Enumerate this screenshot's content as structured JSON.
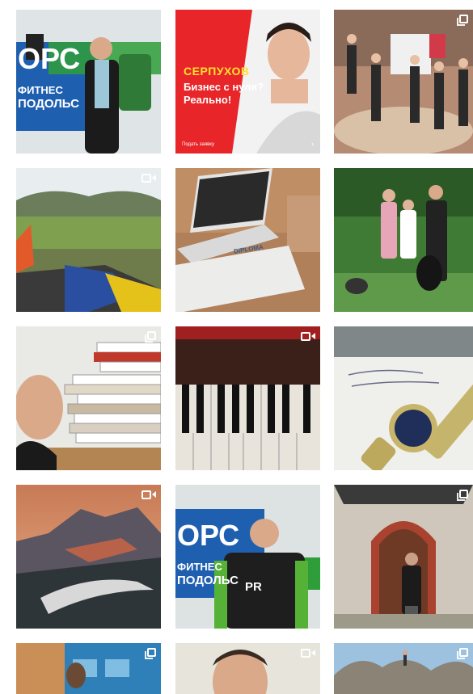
{
  "grid": {
    "tiles": [
      {
        "name": "post-fitness-event",
        "badge": "none"
      },
      {
        "name": "post-ad-serpukhov",
        "badge": "none",
        "ad": {
          "city": "СЕРПУХОВ",
          "headline": "Бизнес с нуля? Реально!",
          "cta": "Подать заявку",
          "arrow": "›"
        }
      },
      {
        "name": "post-group-dancers",
        "badge": "multi"
      },
      {
        "name": "post-motorbike-field",
        "badge": "video"
      },
      {
        "name": "post-diploma-laptop",
        "badge": "none",
        "diploma_title": "DIPLOMA"
      },
      {
        "name": "post-family-dog",
        "badge": "none"
      },
      {
        "name": "post-books-stack",
        "badge": "multi"
      },
      {
        "name": "post-piano-keys",
        "badge": "video"
      },
      {
        "name": "post-watch-note",
        "badge": "none"
      },
      {
        "name": "post-mountain-sunset",
        "badge": "video"
      },
      {
        "name": "post-jersey-logo",
        "badge": "none",
        "jersey_text": "PR"
      },
      {
        "name": "post-arched-door",
        "badge": "multi"
      },
      {
        "name": "post-city-street",
        "badge": "multi"
      },
      {
        "name": "post-selfie",
        "badge": "video"
      },
      {
        "name": "post-rock-landscape",
        "badge": "multi"
      }
    ],
    "brand": {
      "wordmark_top": "ОРС",
      "wordmark_mid": "ФИТНЕС",
      "wordmark_bot": "ПОДОЛЬС"
    }
  },
  "colors": {
    "ad_red": "#e8262a",
    "ad_yellow": "#ffe02e",
    "brand_blue": "#1f5fb0",
    "brand_green": "#2f9e3a"
  }
}
